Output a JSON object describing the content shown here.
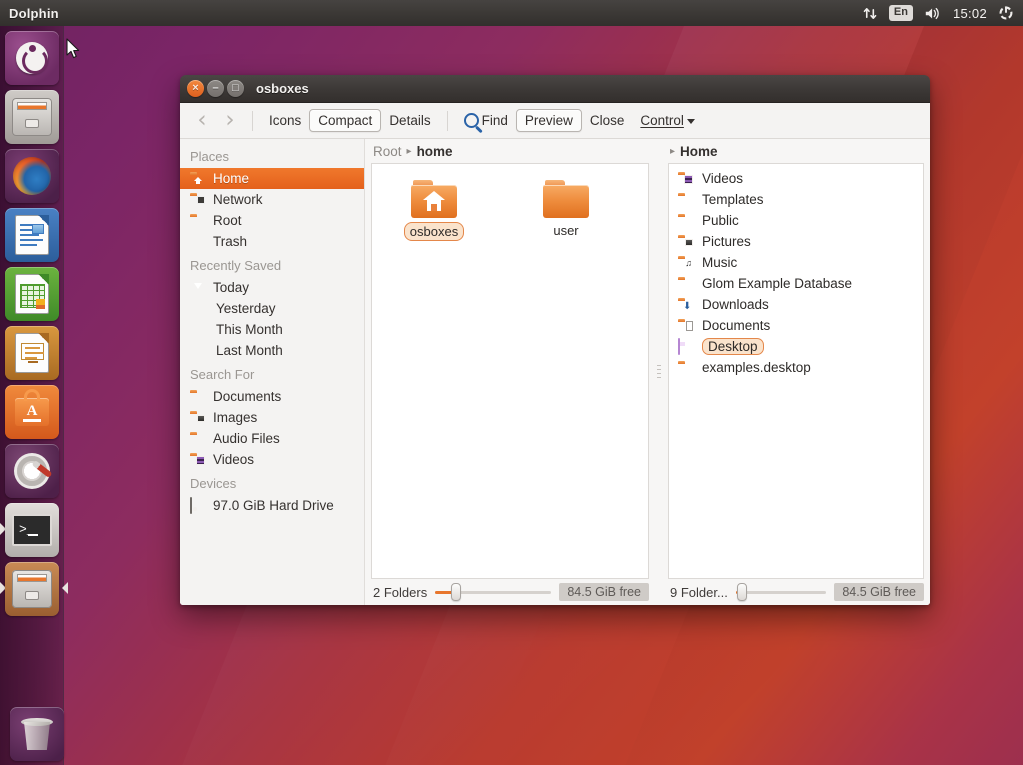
{
  "panel": {
    "app_name": "Dolphin",
    "network_icon": "network-transfer-icon",
    "keyboard_layout": "En",
    "volume_icon": "volume-icon",
    "clock": "15:02",
    "session_icon": "system-power-gear-icon"
  },
  "launcher": {
    "items": [
      {
        "name": "ubuntu-dash",
        "label": "Ubuntu Dash"
      },
      {
        "name": "files-nautilus",
        "label": "Files"
      },
      {
        "name": "firefox",
        "label": "Firefox Web Browser"
      },
      {
        "name": "libreoffice-writer",
        "label": "LibreOffice Writer"
      },
      {
        "name": "libreoffice-calc",
        "label": "LibreOffice Calc"
      },
      {
        "name": "libreoffice-impress",
        "label": "LibreOffice Impress"
      },
      {
        "name": "ubuntu-software-center",
        "label": "Ubuntu Software Center"
      },
      {
        "name": "system-settings",
        "label": "System Settings"
      },
      {
        "name": "terminal",
        "label": "Terminal"
      },
      {
        "name": "dolphin",
        "label": "Dolphin"
      },
      {
        "name": "trash",
        "label": "Trash"
      }
    ]
  },
  "window": {
    "title": "osboxes",
    "close_glyph": "×",
    "minimize_glyph": "–",
    "maximize_glyph": "□"
  },
  "toolbar": {
    "back_glyph": "‹",
    "forward_glyph": "›",
    "icons_label": "Icons",
    "compact_label": "Compact",
    "details_label": "Details",
    "find_label": "Find",
    "preview_label": "Preview",
    "close_label": "Close",
    "control_label": "Control"
  },
  "sidebar": {
    "places_header": "Places",
    "places": [
      {
        "label": "Home",
        "icon": "home-folder-icon",
        "selected": true
      },
      {
        "label": "Network",
        "icon": "network-folder-icon",
        "selected": false
      },
      {
        "label": "Root",
        "icon": "folder-icon",
        "selected": false
      },
      {
        "label": "Trash",
        "icon": "trash-icon",
        "selected": false
      }
    ],
    "recently_saved_header": "Recently Saved",
    "recently_saved": [
      {
        "label": "Today",
        "icon": "recent-icon"
      },
      {
        "label": "Yesterday",
        "icon": ""
      },
      {
        "label": "This Month",
        "icon": ""
      },
      {
        "label": "Last Month",
        "icon": ""
      }
    ],
    "search_for_header": "Search For",
    "search_for": [
      {
        "label": "Documents",
        "icon": "folder-icon"
      },
      {
        "label": "Images",
        "icon": "images-folder-icon"
      },
      {
        "label": "Audio Files",
        "icon": "folder-icon"
      },
      {
        "label": "Videos",
        "icon": "videos-folder-icon"
      }
    ],
    "devices_header": "Devices",
    "devices": [
      {
        "label": "97.0 GiB Hard Drive",
        "icon": "hard-drive-icon"
      }
    ]
  },
  "left_pane": {
    "breadcrumb": {
      "root": "Root",
      "separator": "▸",
      "current": "home"
    },
    "items": [
      {
        "label": "osboxes",
        "icon": "home-folder-icon",
        "selected": true
      },
      {
        "label": "user",
        "icon": "folder-icon",
        "selected": false
      }
    ],
    "status": {
      "count": "2 Folders",
      "free_space": "84.5 GiB free",
      "zoom_percent": 18
    }
  },
  "right_pane": {
    "breadcrumb": {
      "separator": "▸",
      "current": "Home"
    },
    "items": [
      {
        "label": "Videos",
        "icon": "videos-folder-icon",
        "selected": false
      },
      {
        "label": "Templates",
        "icon": "folder-icon",
        "selected": false
      },
      {
        "label": "Public",
        "icon": "folder-icon",
        "selected": false
      },
      {
        "label": "Pictures",
        "icon": "images-folder-icon",
        "selected": false
      },
      {
        "label": "Music",
        "icon": "music-folder-icon",
        "selected": false
      },
      {
        "label": "Glom Example Database",
        "icon": "folder-icon",
        "selected": false
      },
      {
        "label": "Downloads",
        "icon": "downloads-folder-icon",
        "selected": false
      },
      {
        "label": "Documents",
        "icon": "documents-folder-icon",
        "selected": false
      },
      {
        "label": "Desktop",
        "icon": "desktop-icon",
        "selected": true
      },
      {
        "label": "examples.desktop",
        "icon": "folder-icon",
        "selected": false
      }
    ],
    "status": {
      "count": "9 Folder...",
      "free_space": "84.5 GiB free",
      "zoom_percent": 4
    }
  },
  "colors": {
    "accent_orange": "#e8762c",
    "selection_orange": "#ef7220",
    "panel_dark": "#3c3936",
    "desktop_purple": "#6e2361",
    "desktop_orange": "#c2412b",
    "desktop_crimson": "#9d2f4e"
  }
}
